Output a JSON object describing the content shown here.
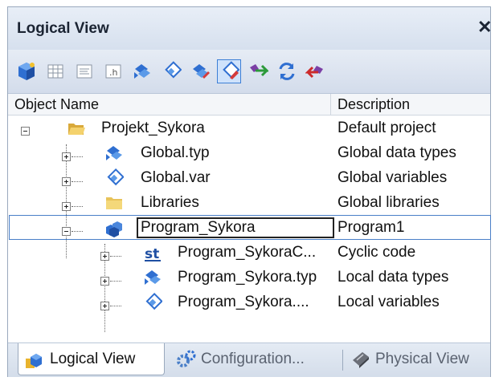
{
  "panel": {
    "title": "Logical View",
    "close_label": "✕"
  },
  "toolbar": {
    "buttons": [
      {
        "icon": "cube-object-icon",
        "active": false
      },
      {
        "icon": "table-icon",
        "active": false
      },
      {
        "icon": "text-file-icon",
        "active": false
      },
      {
        "icon": "header-file-icon",
        "label": ".h",
        "active": false
      },
      {
        "icon": "datatype-icon",
        "active": false
      },
      {
        "icon": "variable-icon",
        "active": false
      },
      {
        "icon": "datatype-edit-icon",
        "active": false
      },
      {
        "icon": "variable-edit-icon",
        "active": true
      },
      {
        "icon": "move-green-icon",
        "active": false
      },
      {
        "icon": "refresh-icon",
        "active": false
      },
      {
        "icon": "move-red-icon",
        "active": false
      }
    ]
  },
  "columns": {
    "name": "Object Name",
    "description": "Description"
  },
  "tree": [
    {
      "name": "Projekt_Sykora",
      "description": "Default project",
      "icon": "folder-open-icon",
      "expander": "minus"
    },
    {
      "name": "Global.typ",
      "description": "Global data types",
      "icon": "datatype-icon",
      "expander": "plus"
    },
    {
      "name": "Global.var",
      "description": "Global variables",
      "icon": "variable-icon",
      "expander": "plus"
    },
    {
      "name": "Libraries",
      "description": "Global libraries",
      "icon": "folder-icon",
      "expander": "plus"
    },
    {
      "name": "Program_Sykora",
      "description": "Program1",
      "icon": "program-icon",
      "expander": "minus",
      "selected": true
    },
    {
      "name": "Program_SykoraC...",
      "description": "Cyclic code",
      "icon": "st-code-icon",
      "expander": "plus"
    },
    {
      "name": "Program_Sykora.typ",
      "description": "Local data types",
      "icon": "datatype-icon",
      "expander": "plus"
    },
    {
      "name": "Program_Sykora....",
      "description": "Local variables",
      "icon": "variable-icon",
      "expander": "plus"
    }
  ],
  "tabs": [
    {
      "label": "Logical View",
      "icon": "logical-view-icon",
      "active": true
    },
    {
      "label": "Configuration...",
      "icon": "configuration-icon",
      "active": false
    },
    {
      "label": "Physical View",
      "icon": "physical-view-icon",
      "active": false
    }
  ],
  "colors": {
    "accent": "#3c7fd6",
    "selection_border": "#4a7fc8",
    "folder": "#e8c35a"
  }
}
